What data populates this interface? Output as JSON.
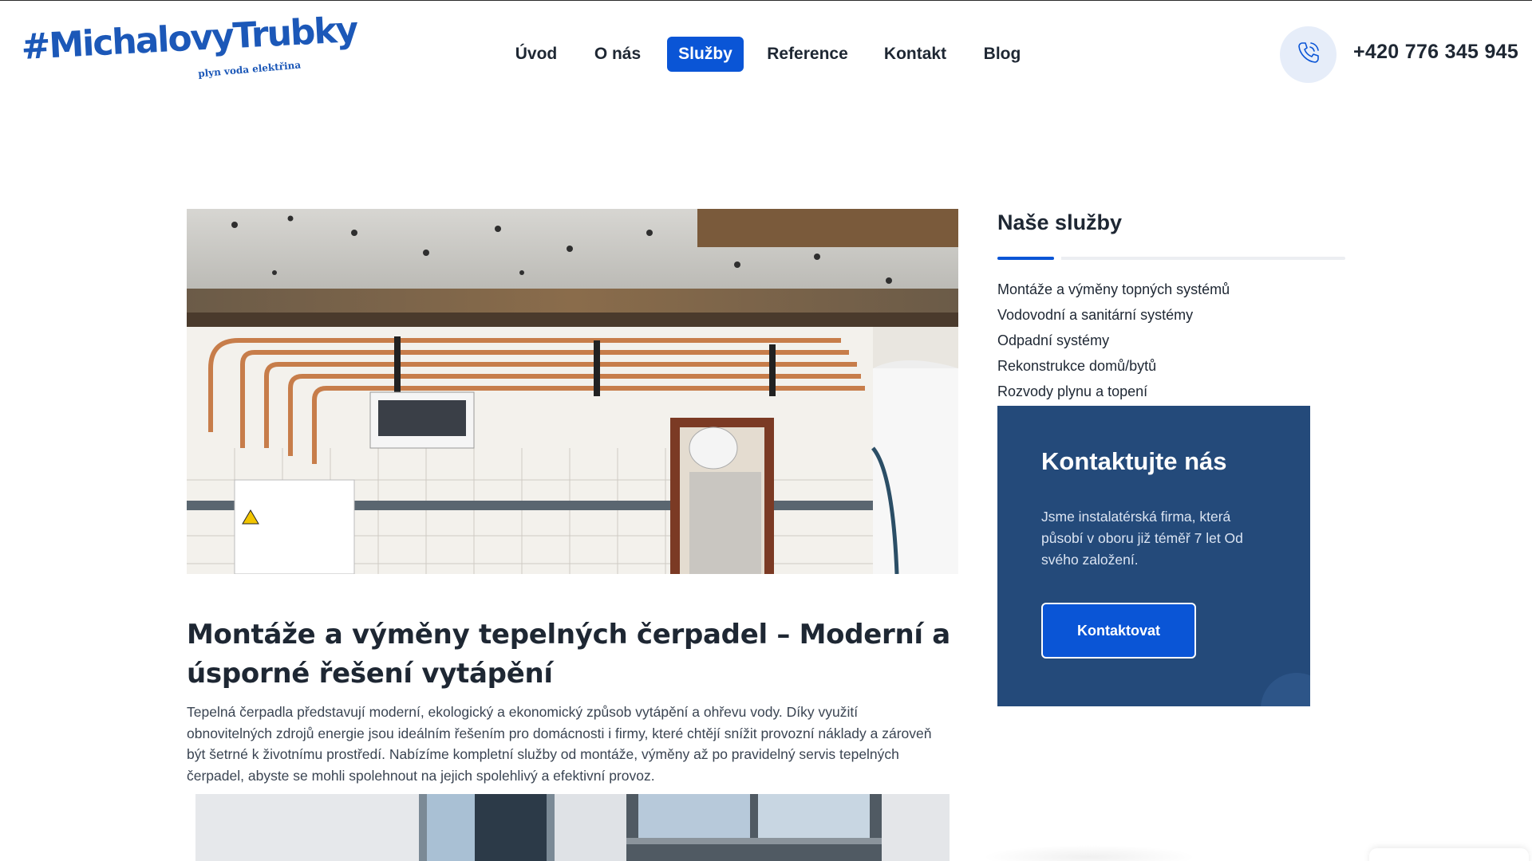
{
  "header": {
    "logo": {
      "main": "#MichalovyTrubky",
      "tagline": "plyn voda elektřina"
    },
    "nav": [
      {
        "label": "Úvod",
        "active": false
      },
      {
        "label": "O nás",
        "active": false
      },
      {
        "label": "Služby",
        "active": true
      },
      {
        "label": "Reference",
        "active": false
      },
      {
        "label": "Kontakt",
        "active": false
      },
      {
        "label": "Blog",
        "active": false
      }
    ],
    "phone": {
      "icon": "phone-icon",
      "number": "+420 776 345 945"
    }
  },
  "main": {
    "hero_image": "photo of copper heating pipes installed along a tiled wall with a boiler",
    "article": {
      "title": "Montáže a výměny tepelných čerpadel – Moderní a úsporné řešení vytápění",
      "body": "Tepelná čerpadla představují moderní, ekologický a ekonomický způsob vytápění a ohřevu vody. Díky využití obnovitelných zdrojů energie jsou ideálním řešením pro domácnosti i firmy, které chtějí snížit provozní náklady a zároveň být šetrné k životnímu prostředí. Nabízíme kompletní služby od montáže, výměny až po pravidelný servis tepelných čerpadel, abyste se mohli spolehnout na jejich spolehlivý a efektivní provoz."
    },
    "second_image": "photo of a building facade with windows"
  },
  "sidebar": {
    "title": "Naše služby",
    "services": [
      "Montáže a výměny topných systémů",
      "Vodovodní a sanitární systémy",
      "Odpadní systémy",
      "Rekonstrukce domů/bytů",
      "Rozvody plynu a topení"
    ],
    "contact": {
      "title": "Kontaktujte nás",
      "text": "Jsme instalatérská firma, která působí v oboru již téměř 7 let Od svého založení.",
      "button": "Kontaktovat"
    }
  },
  "colors": {
    "accent": "#0a55d6",
    "dark_text": "#1e2733",
    "contact_bg": "#244a7a",
    "logo": "#1c58b8"
  }
}
